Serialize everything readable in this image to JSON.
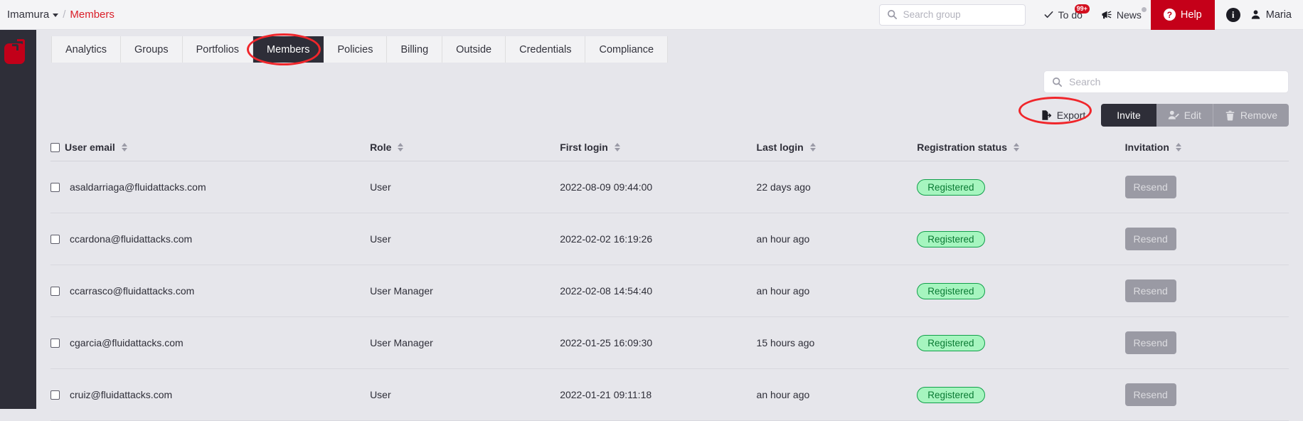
{
  "topbar": {
    "breadcrumb": {
      "org": "Imamura",
      "separator": "/",
      "current": "Members"
    },
    "group_search": {
      "placeholder": "Search group",
      "value": "",
      "icon": "search-icon"
    },
    "nav": [
      {
        "label": "To do",
        "icon": "check-icon",
        "badge": "99+"
      },
      {
        "label": "News",
        "icon": "megaphone-icon",
        "dot": true
      },
      {
        "label": "Help",
        "icon": "question-circle-icon"
      }
    ],
    "info_icon": "i",
    "user": {
      "name": "Maria",
      "icon": "user-icon"
    }
  },
  "sidebar": {
    "logo": "fluid-attacks-logo"
  },
  "tabs": [
    {
      "label": "Analytics",
      "active": false
    },
    {
      "label": "Groups",
      "active": false
    },
    {
      "label": "Portfolios",
      "active": false
    },
    {
      "label": "Members",
      "active": true,
      "annotated": true
    },
    {
      "label": "Policies",
      "active": false
    },
    {
      "label": "Billing",
      "active": false
    },
    {
      "label": "Outside",
      "active": false
    },
    {
      "label": "Credentials",
      "active": false
    },
    {
      "label": "Compliance",
      "active": false
    }
  ],
  "table_search": {
    "placeholder": "Search",
    "value": "",
    "icon": "search-icon"
  },
  "actions": {
    "export": {
      "label": "Export",
      "icon": "export-file-icon",
      "disabled": false,
      "annotated": true
    },
    "invite": {
      "label": "Invite",
      "disabled": false
    },
    "edit": {
      "label": "Edit",
      "icon": "user-edit-icon",
      "disabled": true
    },
    "remove": {
      "label": "Remove",
      "icon": "trash-icon",
      "disabled": true
    }
  },
  "table": {
    "columns": [
      {
        "label": "User email",
        "sortable": true,
        "has_checkbox": true
      },
      {
        "label": "Role",
        "sortable": true
      },
      {
        "label": "First login",
        "sortable": true
      },
      {
        "label": "Last login",
        "sortable": true
      },
      {
        "label": "Registration status",
        "sortable": true
      },
      {
        "label": "Invitation",
        "sortable": true
      }
    ],
    "resend_label": "Resend",
    "rows": [
      {
        "email": "asaldarriaga@fluidattacks.com",
        "role": "User",
        "first_login": "2022-08-09 09:44:00",
        "last_login": "22 days ago",
        "status": "Registered",
        "invitation": "Resend"
      },
      {
        "email": "ccardona@fluidattacks.com",
        "role": "User",
        "first_login": "2022-02-02 16:19:26",
        "last_login": "an hour ago",
        "status": "Registered",
        "invitation": "Resend"
      },
      {
        "email": "ccarrasco@fluidattacks.com",
        "role": "User Manager",
        "first_login": "2022-02-08 14:54:40",
        "last_login": "an hour ago",
        "status": "Registered",
        "invitation": "Resend"
      },
      {
        "email": "cgarcia@fluidattacks.com",
        "role": "User Manager",
        "first_login": "2022-01-25 16:09:30",
        "last_login": "15 hours ago",
        "status": "Registered",
        "invitation": "Resend"
      },
      {
        "email": "cruiz@fluidattacks.com",
        "role": "User",
        "first_login": "2022-01-21 09:11:18",
        "last_login": "an hour ago",
        "status": "Registered",
        "invitation": "Resend"
      }
    ]
  },
  "colors": {
    "brand_red": "#c20019",
    "help_red": "#c50019",
    "accent_link": "#da1e28",
    "dark": "#2e2e38",
    "page_bg": "#e6e6eb",
    "status_green_bg": "#a6f5bf",
    "status_green_fg": "#0a7a33",
    "annotation_red": "#f0262b"
  }
}
